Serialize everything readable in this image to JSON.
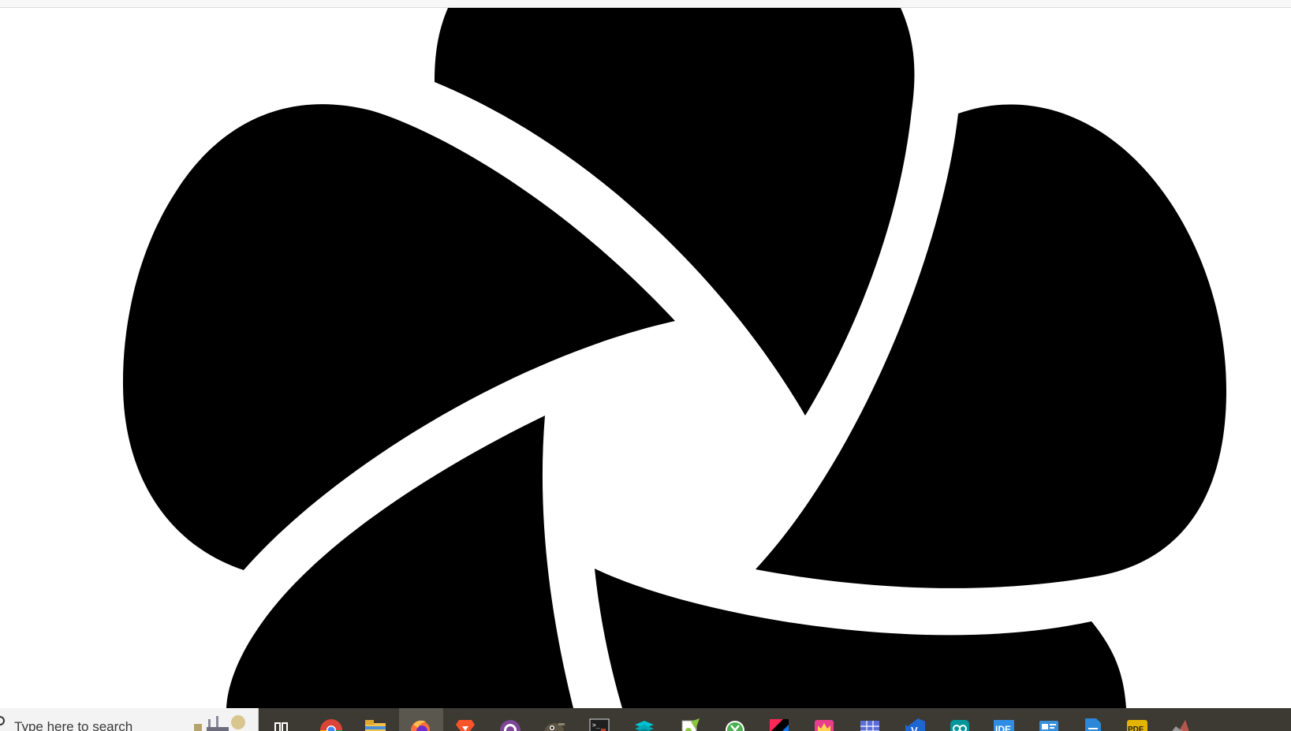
{
  "taskbar": {
    "search_placeholder": "Type here to search",
    "apps": [
      {
        "name": "task-view-icon",
        "color": "#ffffff"
      },
      {
        "name": "chrome-icon",
        "color": "#db4437"
      },
      {
        "name": "file-explorer-icon",
        "color": "#f2c14e"
      },
      {
        "name": "firefox-icon",
        "color": "#ff7139"
      },
      {
        "name": "brave-icon",
        "color": "#fb542b"
      },
      {
        "name": "tor-browser-icon",
        "color": "#7d4698"
      },
      {
        "name": "gimp-icon",
        "color": "#5c5543"
      },
      {
        "name": "terminal-icon",
        "color": "#1f1f1f"
      },
      {
        "name": "layers-app-icon",
        "color": "#00a8b5"
      },
      {
        "name": "notepad-plus-plus-icon",
        "color": "#8cc63f"
      },
      {
        "name": "green-circle-app-icon",
        "color": "#4caf50"
      },
      {
        "name": "intellij-icon",
        "color": "#fe2857"
      },
      {
        "name": "crown-app-icon",
        "color": "#e83e8c"
      },
      {
        "name": "grid-app-icon",
        "color": "#5b6ed6"
      },
      {
        "name": "visual-studio-icon",
        "color": "#1e66d2"
      },
      {
        "name": "arduino-icon",
        "color": "#00979c"
      },
      {
        "name": "ide-icon",
        "color": "#2e8ee5"
      },
      {
        "name": "card-app-icon",
        "color": "#3a8fd9"
      },
      {
        "name": "document-app-icon",
        "color": "#2b88d8"
      },
      {
        "name": "pdf-app-icon",
        "color": "#e5b400"
      },
      {
        "name": "matlab-icon",
        "color": "#999999"
      }
    ],
    "ide_label": "IDE",
    "pdf_label": "PDF",
    "terminal_label": ">_"
  },
  "colors": {
    "logo_fill": "#000000",
    "background": "#ffffff",
    "taskbar_bg": "#3c3a33"
  }
}
